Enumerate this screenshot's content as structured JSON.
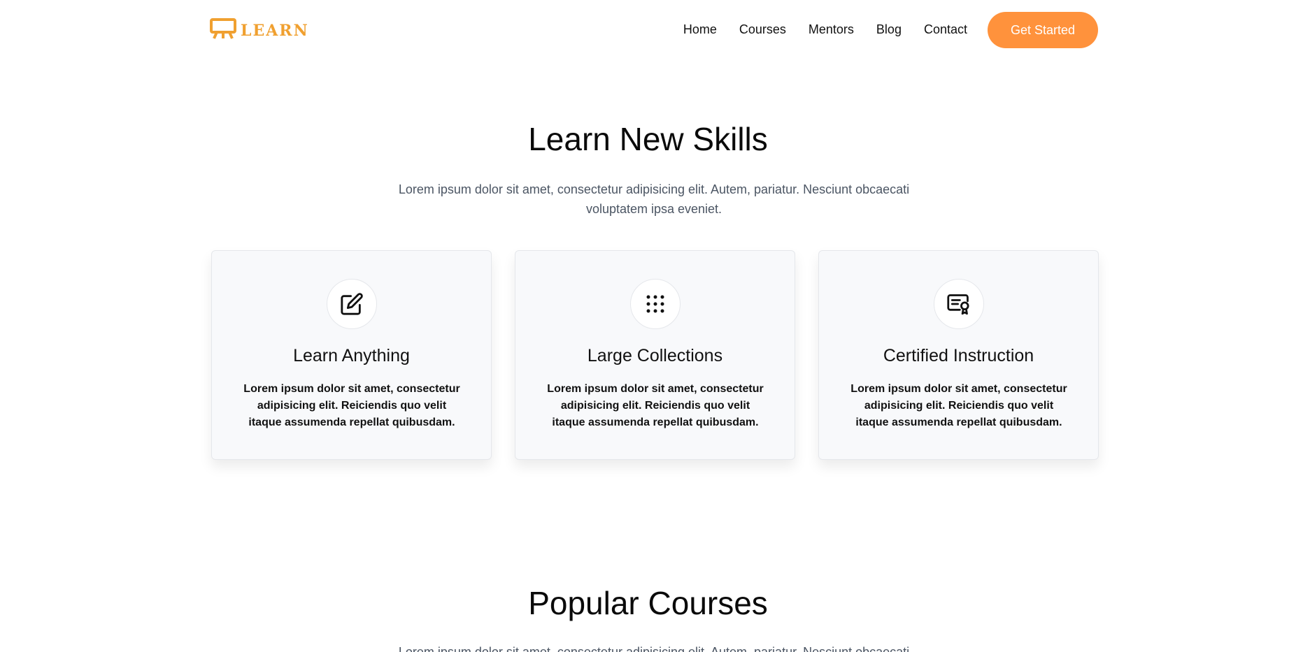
{
  "nav": {
    "logo_text": "LEARN",
    "links": [
      "Home",
      "Courses",
      "Mentors",
      "Blog",
      "Contact"
    ],
    "cta": "Get Started"
  },
  "skills": {
    "title": "Learn New Skills",
    "subtitle": "Lorem ipsum dolor sit amet, consectetur adipisicing elit. Autem, pariatur. Nesciunt obcaecati voluptatem ipsa eveniet.",
    "cards": [
      {
        "icon": "edit-icon",
        "title": "Learn Anything",
        "text": "Lorem ipsum dolor sit amet, consectetur adipisicing elit. Reiciendis quo velit itaque assumenda repellat quibusdam."
      },
      {
        "icon": "grid-dots-icon",
        "title": "Large Collections",
        "text": "Lorem ipsum dolor sit amet, consectetur adipisicing elit. Reiciendis quo velit itaque assumenda repellat quibusdam."
      },
      {
        "icon": "certificate-icon",
        "title": "Certified Instruction",
        "text": "Lorem ipsum dolor sit amet, consectetur adipisicing elit. Reiciendis quo velit itaque assumenda repellat quibusdam."
      }
    ]
  },
  "courses": {
    "title": "Popular Courses",
    "subtitle": "Lorem ipsum dolor sit amet, consectetur adipisicing elit. Autem, pariatur. Nesciunt obcaecati"
  },
  "colors": {
    "accent": "#ff923c",
    "logo": "#f0a030"
  }
}
